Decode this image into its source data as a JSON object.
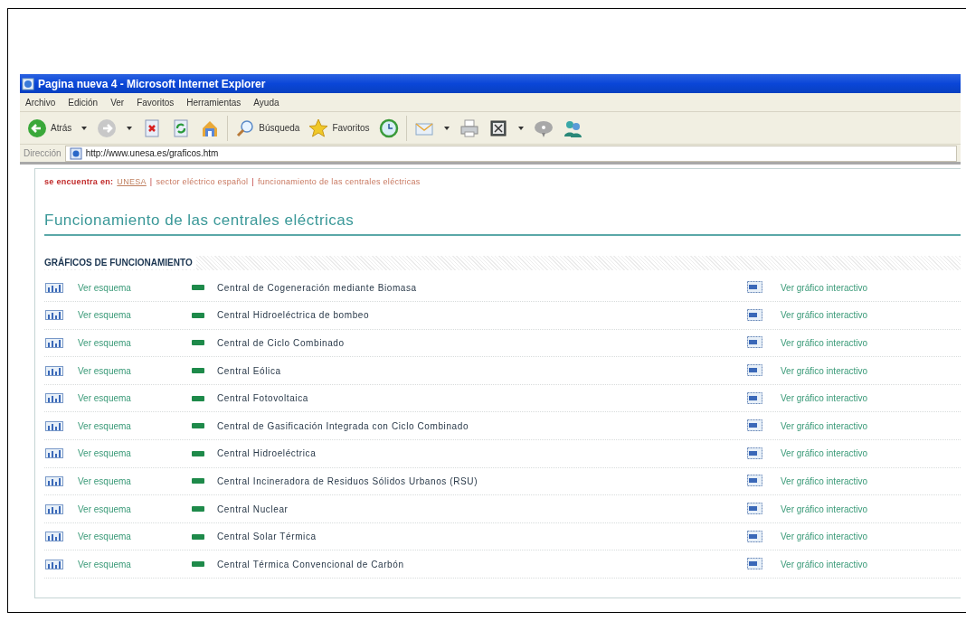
{
  "window": {
    "title": "Pagina nueva 4 - Microsoft Internet Explorer"
  },
  "menu": [
    "Archivo",
    "Edición",
    "Ver",
    "Favoritos",
    "Herramientas",
    "Ayuda"
  ],
  "toolbar": [
    {
      "kind": "back",
      "label": "Atrás",
      "dropdown": true
    },
    {
      "kind": "forward",
      "dropdown": true
    },
    {
      "kind": "stop"
    },
    {
      "kind": "refresh"
    },
    {
      "kind": "home"
    },
    {
      "kind": "search",
      "label": "Búsqueda"
    },
    {
      "kind": "favorites",
      "label": "Favoritos"
    },
    {
      "kind": "history"
    },
    {
      "kind": "mail",
      "dropdown": true
    },
    {
      "kind": "print"
    },
    {
      "kind": "edit",
      "dropdown": true
    },
    {
      "kind": "discuss"
    },
    {
      "kind": "messenger"
    }
  ],
  "address": {
    "label": "Dirección",
    "url": "http://www.unesa.es/graficos.htm"
  },
  "breadcrumb": [
    {
      "kind": "label",
      "text": "se encuentra en:"
    },
    {
      "kind": "link",
      "text": "UNESA"
    },
    {
      "kind": "separator",
      "text": "|"
    },
    {
      "kind": "text",
      "text": "sector eléctrico español"
    },
    {
      "kind": "separator",
      "text": "|"
    },
    {
      "kind": "text",
      "text": "funcionamiento de las centrales eléctricas"
    }
  ],
  "heading": "Funcionamiento de las centrales eléctricas",
  "section_title": "GRÁFICOS DE FUNCIONAMIENTO",
  "rows": [
    {
      "scheme_link": "Ver esquema",
      "name": "Central de Cogeneración mediante Biomasa",
      "interactive_link": "Ver gráfico interactivo"
    },
    {
      "scheme_link": "Ver esquema",
      "name": "Central Hidroeléctrica de bombeo",
      "interactive_link": "Ver gráfico interactivo"
    },
    {
      "scheme_link": "Ver esquema",
      "name": "Central de Ciclo Combinado",
      "interactive_link": "Ver gráfico interactivo"
    },
    {
      "scheme_link": "Ver esquema",
      "name": "Central Eólica",
      "interactive_link": "Ver gráfico interactivo"
    },
    {
      "scheme_link": "Ver esquema",
      "name": "Central Fotovoltaica",
      "interactive_link": "Ver gráfico interactivo"
    },
    {
      "scheme_link": "Ver esquema",
      "name": "Central de Gasificación Integrada con Ciclo Combinado",
      "interactive_link": "Ver gráfico interactivo"
    },
    {
      "scheme_link": "Ver esquema",
      "name": "Central Hidroeléctrica",
      "interactive_link": "Ver gráfico interactivo"
    },
    {
      "scheme_link": "Ver esquema",
      "name": "Central Incineradora de Residuos Sólidos Urbanos (RSU)",
      "interactive_link": "Ver gráfico interactivo"
    },
    {
      "scheme_link": "Ver esquema",
      "name": "Central Nuclear",
      "interactive_link": "Ver gráfico interactivo"
    },
    {
      "scheme_link": "Ver esquema",
      "name": "Central Solar Térmica",
      "interactive_link": "Ver gráfico interactivo"
    },
    {
      "scheme_link": "Ver esquema",
      "name": "Central Térmica Convencional de Carbón",
      "interactive_link": "Ver gráfico interactivo"
    }
  ]
}
